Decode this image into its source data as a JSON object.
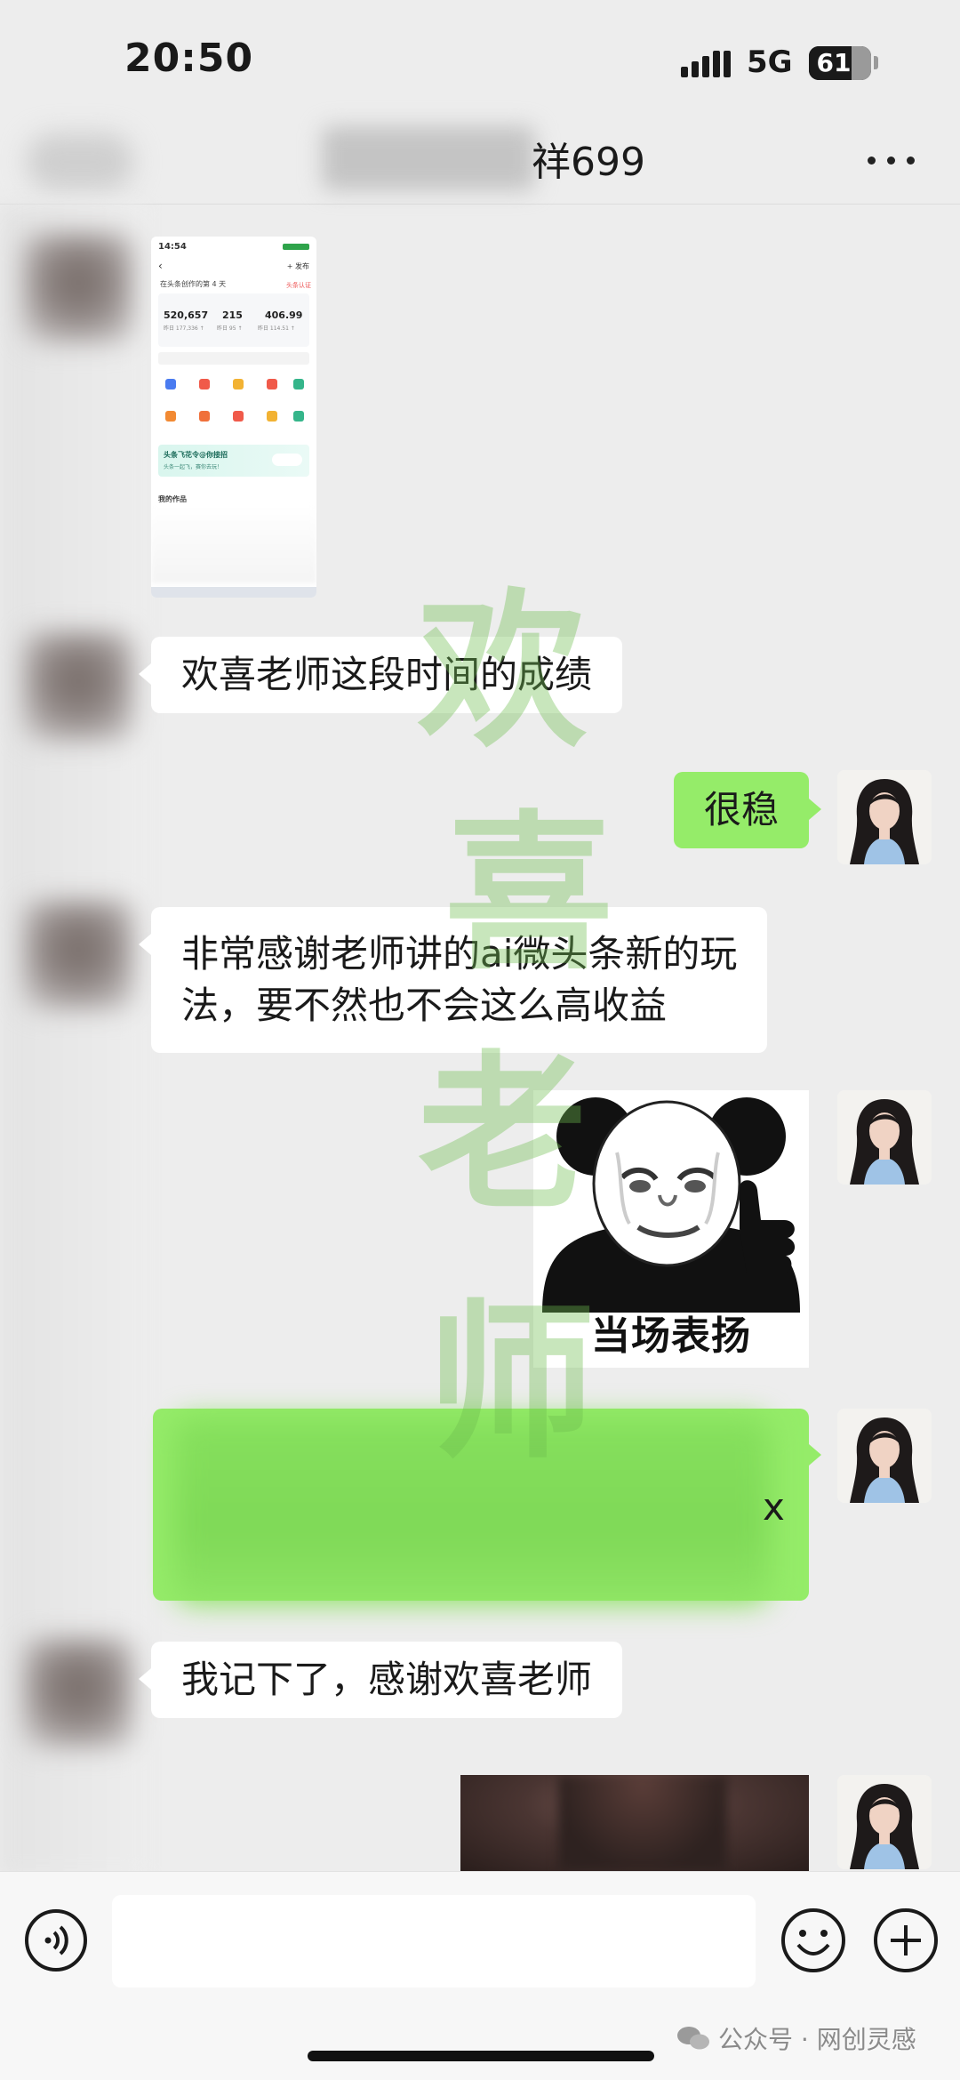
{
  "status_bar": {
    "time": "20:50",
    "network": "5G",
    "battery_level": "61",
    "battery_fraction": 0.61
  },
  "header": {
    "title_visible": "祥699",
    "more_icon": "more-dots-icon"
  },
  "thumbnail": {
    "time": "14:54",
    "back": "‹",
    "publish": "+ 发布",
    "profile_line": "在头条创作的第 4 天",
    "profile_tag": "头条认证",
    "stats": [
      {
        "value": "520,657",
        "sub": "昨日 177,336 ↑"
      },
      {
        "value": "215",
        "sub": "昨日 95 ↑"
      },
      {
        "value": "406.99",
        "sub": "昨日 114.51 ↑"
      }
    ],
    "banner_title": "头条飞花令@你接招",
    "banner_sub": "头条一起飞，赛你去玩！",
    "works_label": "我的作品"
  },
  "messages": [
    {
      "id": 1,
      "side": "in",
      "type": "image",
      "description": "screenshot"
    },
    {
      "id": 2,
      "side": "in",
      "type": "text",
      "text": "欢喜老师这段时间的成绩"
    },
    {
      "id": 3,
      "side": "out",
      "type": "text",
      "text": "很稳"
    },
    {
      "id": 4,
      "side": "in",
      "type": "text",
      "line1": "非常感谢老师讲的ai微头条新的玩",
      "line2": "法，要不然也不会这么高收益"
    },
    {
      "id": 5,
      "side": "out",
      "type": "sticker",
      "caption": "当场表扬"
    },
    {
      "id": 6,
      "side": "out",
      "type": "text-blurred",
      "visible_fragment": "x"
    },
    {
      "id": 7,
      "side": "in",
      "type": "text",
      "text": "我记下了，感谢欢喜老师"
    },
    {
      "id": 8,
      "side": "out",
      "type": "image"
    }
  ],
  "watermark": [
    "欢",
    "喜",
    "老",
    "师"
  ],
  "input_bar": {
    "placeholder": "",
    "voice_icon": "voice-icon",
    "emoji_icon": "emoji-icon",
    "plus_icon": "plus-icon"
  },
  "footer": {
    "credit": "公众号 · 网创灵感"
  },
  "colors": {
    "background": "#ededed",
    "bubble_out": "#95ec69",
    "bubble_in": "#ffffff",
    "watermark": "#6ebe50"
  }
}
